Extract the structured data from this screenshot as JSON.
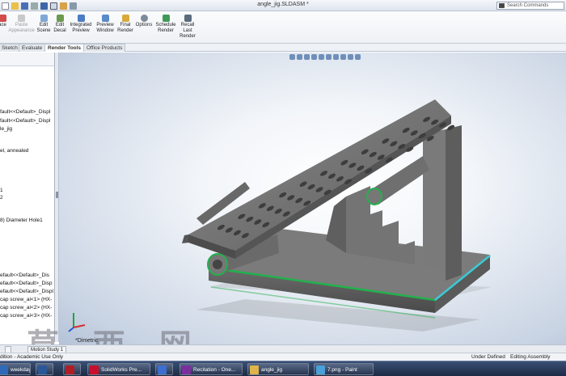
{
  "window": {
    "title": "angle_jig.SLDASM *",
    "search_placeholder": "Search Commands"
  },
  "ribbon": {
    "buttons": [
      {
        "label": "ace",
        "icon": "appearance-icon",
        "enabled": true
      },
      {
        "label": "Paste Appearance",
        "icon": "paste-appearance-icon",
        "enabled": false
      },
      {
        "label": "Edit Scene",
        "icon": "scene-icon",
        "enabled": true
      },
      {
        "label": "Edit Decal",
        "icon": "decal-icon",
        "enabled": true
      },
      {
        "label": "Integrated Preview",
        "icon": "preview-icon",
        "enabled": true
      },
      {
        "label": "Preview Window",
        "icon": "window-icon",
        "enabled": true
      },
      {
        "label": "Final Render",
        "icon": "render-icon",
        "enabled": true
      },
      {
        "label": "Options",
        "icon": "gear-icon",
        "enabled": true
      },
      {
        "label": "Schedule Render",
        "icon": "schedule-icon",
        "enabled": true
      },
      {
        "label": "Recall Last Render",
        "icon": "recall-icon",
        "enabled": true
      }
    ]
  },
  "tabs": [
    "Sketch",
    "Evaluate",
    "Render Tools",
    "Office Products"
  ],
  "active_tab": "Render Tools",
  "tree": {
    "lines": [
      "fault<<Default>_Displ",
      "fault<<Default>_Displ",
      "le_jig",
      "el, annealed",
      "1",
      "2",
      "8) Diameter Hole1",
      "efault<<Default>_Dis",
      "efault<<Default>_Disp",
      "efault<<Default>_Displ",
      "cap screw_ai<1> (HX-",
      "cap screw_ai<2> (HX-",
      "cap screw_ai<3> (HX-"
    ]
  },
  "viewport": {
    "view_label": "*Dimetric"
  },
  "bottom_tabs": [
    "Motion Study 1"
  ],
  "status": {
    "left": "dition - Academic Use Only",
    "mid": "Under Defined",
    "right": "Editing Assembly"
  },
  "taskbar": {
    "items": [
      {
        "label": "weekday",
        "color": "#2f6ab8"
      },
      {
        "label": "",
        "color": "#2b5797"
      },
      {
        "label": "",
        "color": "#b01e23"
      },
      {
        "label": "SolidWorks Pre...",
        "color": "#c8102e"
      },
      {
        "label": "",
        "color": "#3b6ed0"
      },
      {
        "label": "Recitation - One...",
        "color": "#7b2f9e"
      },
      {
        "label": "angle_jig",
        "color": "#e0b44a"
      },
      {
        "label": "7.png - Paint",
        "color": "#4aa0d8"
      }
    ]
  },
  "watermark": "莫 西 网",
  "colors": {
    "part_gray": "#6f6f6f",
    "edge_green": "#22b14c",
    "edge_cyan": "#3ec7d8"
  }
}
